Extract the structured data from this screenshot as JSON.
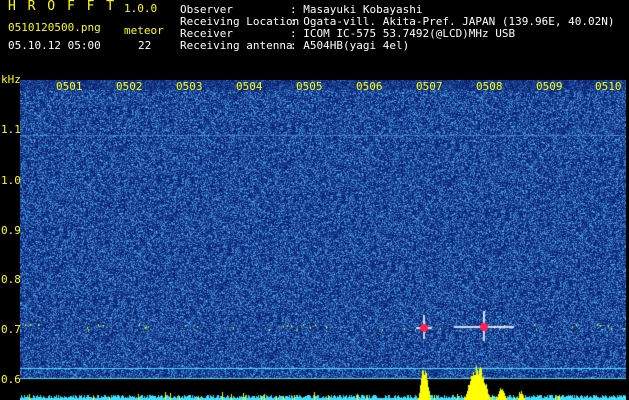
{
  "app": {
    "name": "H R O F F T",
    "version": "1.0.0"
  },
  "file": {
    "name": "0510120500.png",
    "datetime": "05.10.12 05:00"
  },
  "meteor": {
    "label": "meteor",
    "count": "22"
  },
  "info": [
    {
      "label": "Observer",
      "value": ": Masayuki Kobayashi"
    },
    {
      "label": "Receiving Location",
      "value": ": Ogata-vill. Akita-Pref. JAPAN (139.96E, 40.02N)"
    },
    {
      "label": "Receiver",
      "value": ": ICOM IC-575 53.7492(@LCD)MHz USB"
    },
    {
      "label": "Receiving antenna",
      "value": ": A504HB(yagi 4el)"
    }
  ],
  "y_axis": {
    "unit": "kHz",
    "ticks": [
      "1.1",
      "1.0",
      "0.9",
      "0.8",
      "0.7",
      "0.6"
    ]
  },
  "x_axis": {
    "ticks": [
      "0501",
      "0502",
      "0503",
      "0504",
      "0505",
      "0506",
      "0507",
      "0508",
      "0509",
      "0510"
    ]
  },
  "colors": {
    "background": "#000000",
    "noise_dark": "#0a1a78",
    "noise_bright": "#3aa8ff",
    "label_yellow": "#ffff00",
    "label_white": "#ffffff",
    "meteor_red": "#ff2050",
    "meteor_line": "#ffffff",
    "histogram": "#ffff00",
    "baseline": "#40e0ff",
    "carrier": "#c8ff00"
  }
}
